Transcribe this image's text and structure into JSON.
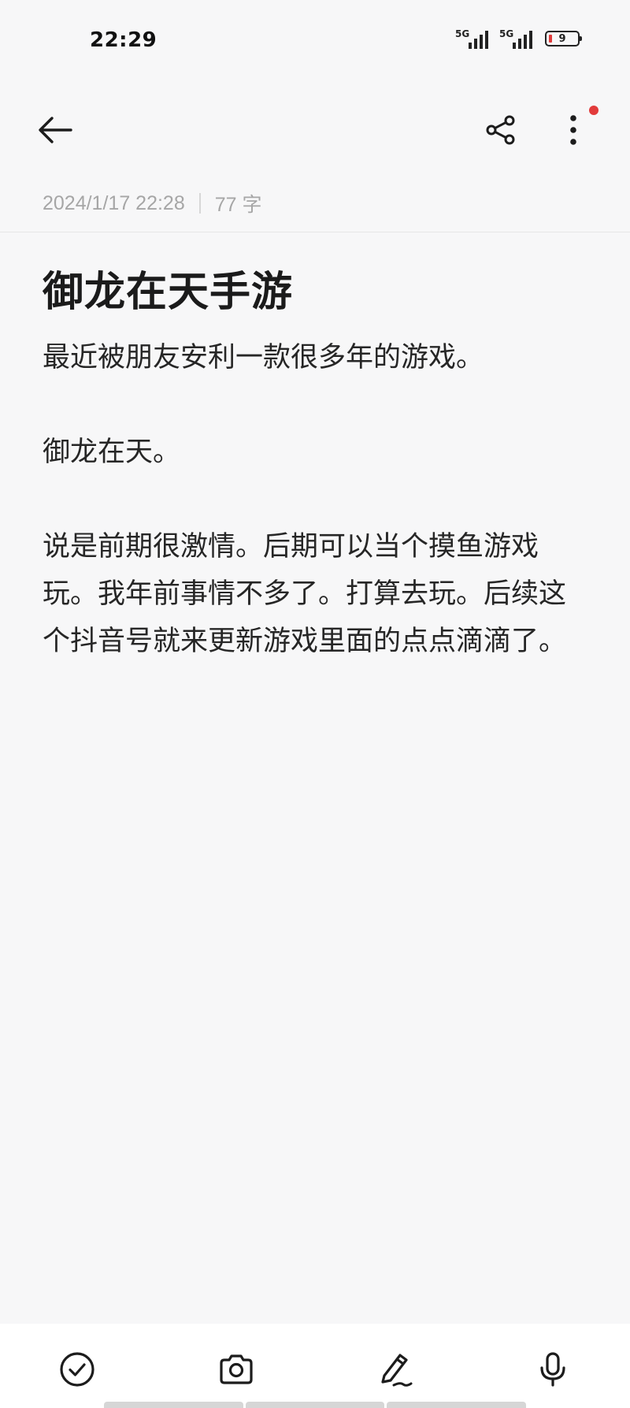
{
  "status_bar": {
    "time": "22:29",
    "signal1_label": "5G",
    "signal2_label": "5G",
    "battery_level": "9",
    "battery_color": "#e03a3a"
  },
  "toolbar": {
    "back_icon": "arrow-left-icon",
    "share_icon": "share-icon",
    "more_icon": "more-vertical-icon",
    "notification_dot_color": "#e23b3b"
  },
  "note": {
    "date": "2024/1/17 22:28",
    "word_count": "77 字",
    "title": "御龙在天手游",
    "paragraphs": [
      "最近被朋友安利一款很多年的游戏。",
      "御龙在天。",
      "说是前期很激情。后期可以当个摸鱼游戏玩。我年前事情不多了。打算去玩。后续这个抖音号就来更新游戏里面的点点滴滴了。"
    ]
  },
  "bottom_bar": {
    "icons": [
      "check-circle-icon",
      "camera-icon",
      "pen-icon",
      "microphone-icon"
    ]
  }
}
